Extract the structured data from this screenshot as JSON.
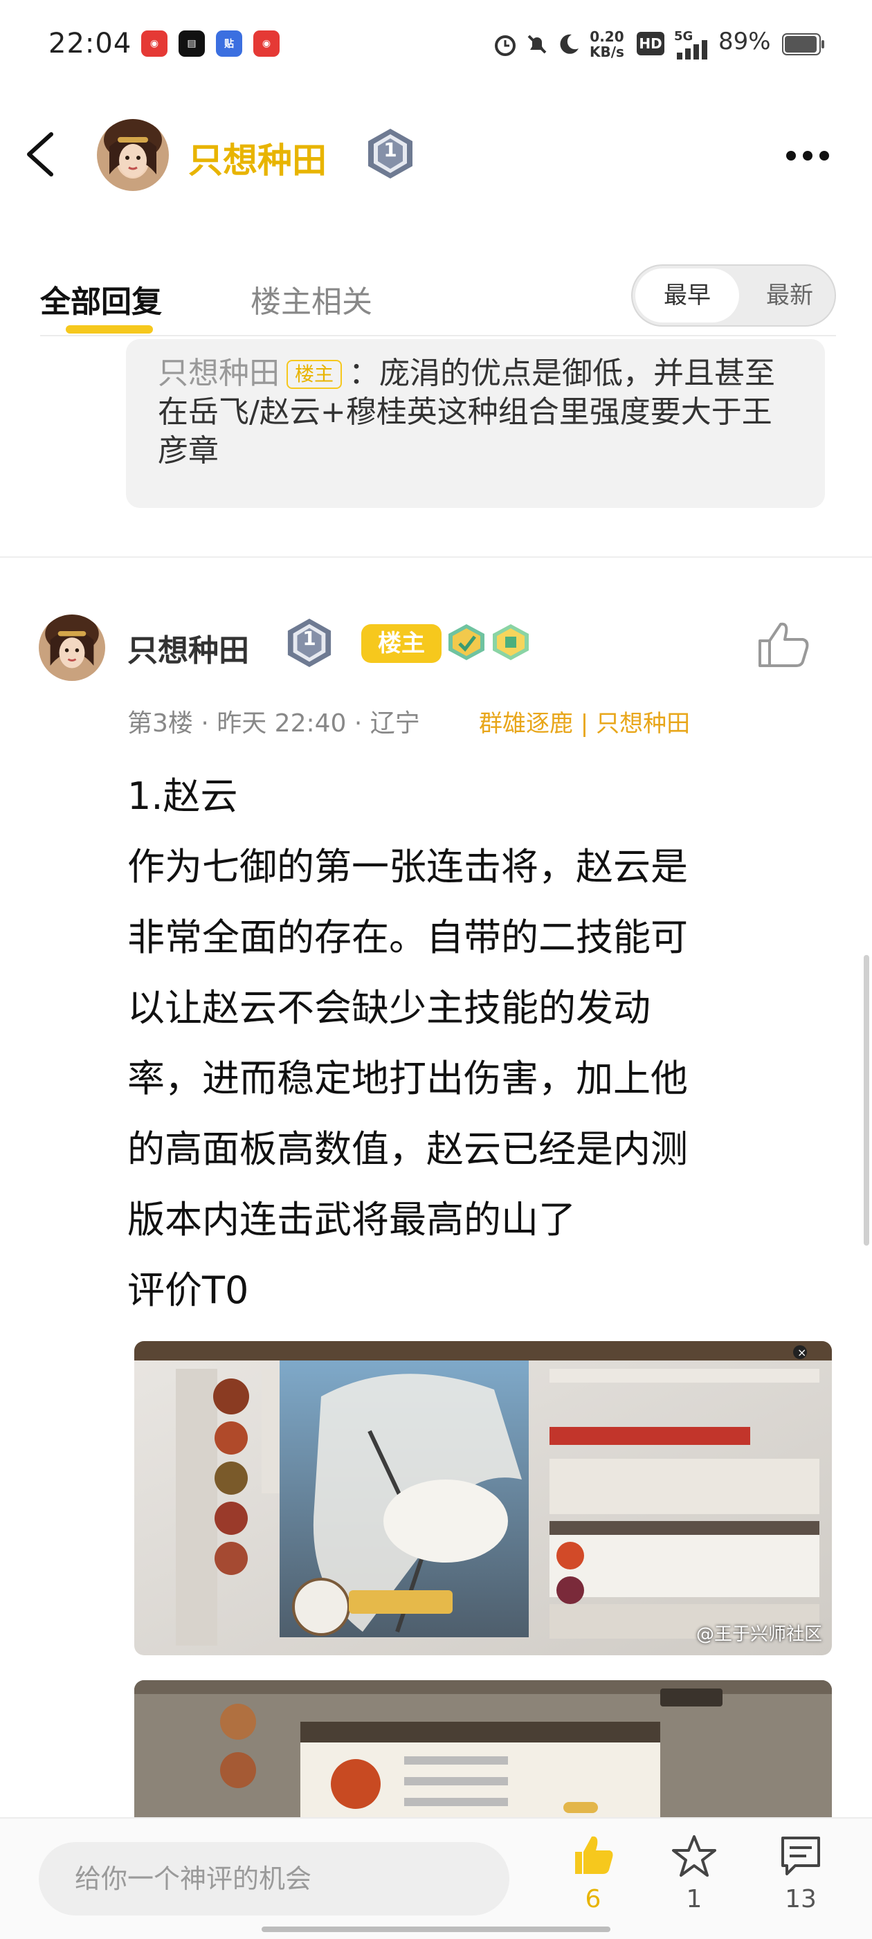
{
  "status_bar": {
    "time": "22:04",
    "network_speed": "0.20\nKB/s",
    "hd_label": "HD",
    "signal_label": "5G",
    "battery": "89%"
  },
  "header": {
    "title": "只想种田",
    "level": "1"
  },
  "tabs": {
    "all_replies": "全部回复",
    "op_related": "楼主相关",
    "sort_earliest": "最早",
    "sort_latest": "最新"
  },
  "quote": {
    "author": "只想种田",
    "op_tag": "楼主",
    "text": "：庞涓的优点是御低，并且甚至在岳飞/赵云+穆桂英这种组合里强度要大于王彦章"
  },
  "post": {
    "username": "只想种田",
    "level": "1",
    "op_tag": "楼主",
    "meta": "第3楼 · 昨天 22:40 · 辽宁",
    "source": "群雄逐鹿 | 只想种田",
    "lines": [
      "1.赵云",
      "作为七御的第一张连击将，赵云是",
      "非常全面的存在。自带的二技能可",
      "以让赵云不会缺少主技能的发动",
      "率，进而稳定地打出伤害，加上他",
      "的高面板高数值，赵云已经是内测",
      "版本内连击武将最高的山了",
      "评价T0"
    ],
    "image_watermark": "@王于兴师社区"
  },
  "bottom_bar": {
    "comment_placeholder": "给你一个神评的机会",
    "like_count": "6",
    "favorite_count": "1",
    "comment_count": "13"
  },
  "colors": {
    "accent": "#f6c81d",
    "username_accent": "#e8b400",
    "source_orange": "#e8a61a"
  }
}
